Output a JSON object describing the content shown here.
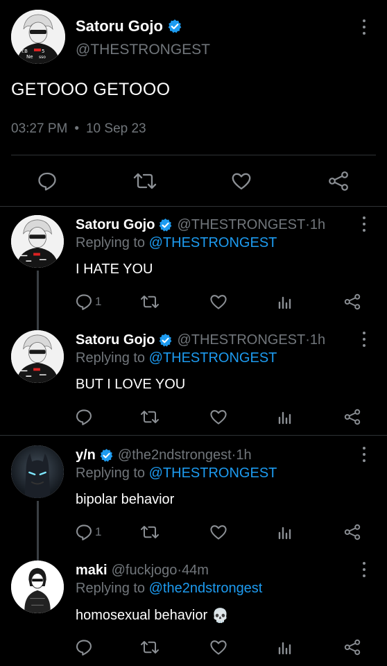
{
  "main_tweet": {
    "name": "Satoru Gojo",
    "handle": "@THESTRONGEST",
    "text": "GETOOO GETOOO",
    "time": "03:27 PM",
    "separator": "•",
    "date": "10 Sep 23",
    "verified": true
  },
  "replies": [
    {
      "name": "Satoru Gojo",
      "handle": "@THESTRONGEST",
      "sep": " · ",
      "time": "1h",
      "replying_label": "Replying to",
      "replying_to": "@THESTRONGEST",
      "text": "I HATE YOU",
      "reply_count": "1",
      "verified": true,
      "avatar": "gojo"
    },
    {
      "name": "Satoru Gojo",
      "handle": "@THESTRONGEST",
      "sep": " · ",
      "time": "1h",
      "replying_label": "Replying to",
      "replying_to": "@THESTRONGEST",
      "text": "BUT I LOVE YOU",
      "reply_count": "",
      "verified": true,
      "avatar": "gojo"
    },
    {
      "name": "y/n",
      "handle": "@the2ndstrongest",
      "sep": " · ",
      "time": "1h",
      "replying_label": "Replying to",
      "replying_to": "@THESTRONGEST",
      "text": "bipolar behavior",
      "reply_count": "1",
      "verified": true,
      "avatar": "batman"
    },
    {
      "name": "maki",
      "handle": "@fuckjogo",
      "sep": " · ",
      "time": "44m",
      "replying_label": "Replying to",
      "replying_to": "@the2ndstrongest",
      "text": "homosexual behavior",
      "emoji": "💀",
      "reply_count": "",
      "verified": false,
      "avatar": "maki"
    }
  ],
  "colors": {
    "background": "#000000",
    "accent": "#1d9bf0",
    "muted": "#71767b",
    "text": "#e7e9ea"
  }
}
